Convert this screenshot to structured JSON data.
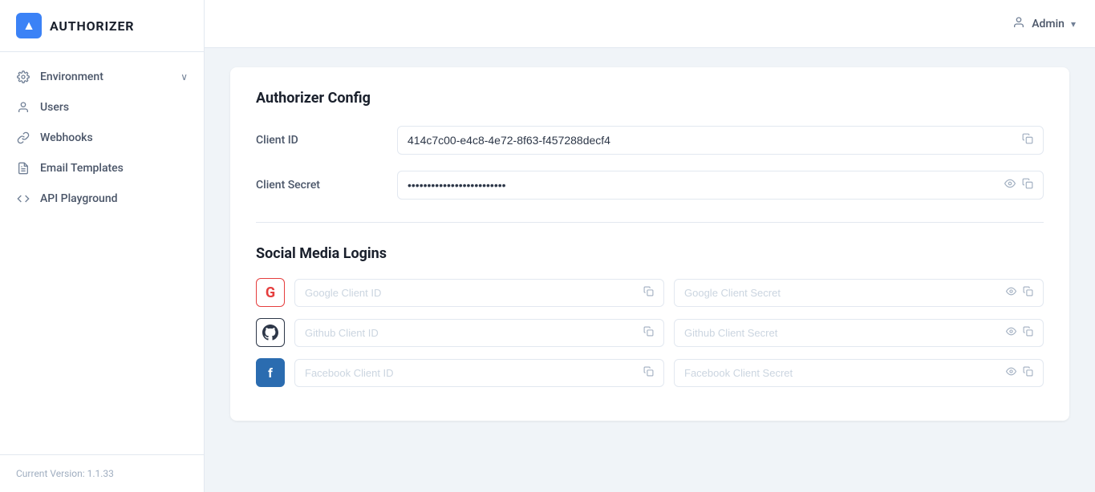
{
  "app": {
    "name": "AUTHORIZER",
    "logo_letter": "▲",
    "version_label": "Current Version: 1.1.33"
  },
  "header": {
    "admin_label": "Admin",
    "admin_chevron": "▾"
  },
  "sidebar": {
    "items": [
      {
        "id": "environment",
        "label": "Environment",
        "icon": "gear",
        "has_chevron": true
      },
      {
        "id": "users",
        "label": "Users",
        "icon": "user"
      },
      {
        "id": "webhooks",
        "label": "Webhooks",
        "icon": "link"
      },
      {
        "id": "email-templates",
        "label": "Email Templates",
        "icon": "doc"
      },
      {
        "id": "api-playground",
        "label": "API Playground",
        "icon": "code"
      }
    ]
  },
  "main": {
    "authorizer_config": {
      "title": "Authorizer Config",
      "fields": [
        {
          "id": "client-id",
          "label": "Client ID",
          "value": "414c7c00-e4c8-4e72-8f63-f457288decf4",
          "type": "text",
          "has_copy": true,
          "has_eye": false
        },
        {
          "id": "client-secret",
          "label": "Client Secret",
          "value": "••••••••••••••••••••••••••••••••",
          "type": "password",
          "has_copy": true,
          "has_eye": true
        }
      ]
    },
    "social_media": {
      "title": "Social Media Logins",
      "providers": [
        {
          "id": "google",
          "logo": "G",
          "style": "google",
          "client_id_placeholder": "Google Client ID",
          "client_secret_placeholder": "Google Client Secret"
        },
        {
          "id": "github",
          "logo": "🐙",
          "style": "github",
          "client_id_placeholder": "Github Client ID",
          "client_secret_placeholder": "Github Client Secret"
        },
        {
          "id": "facebook",
          "logo": "f",
          "style": "facebook",
          "client_id_placeholder": "Facebook Client ID",
          "client_secret_placeholder": "Facebook Client Secret"
        }
      ]
    }
  },
  "icons": {
    "copy": "⧉",
    "eye": "👁",
    "gear": "⚙",
    "user": "👤",
    "link": "🔗",
    "doc": "📄",
    "code": "</>",
    "chevron_down": "›"
  }
}
